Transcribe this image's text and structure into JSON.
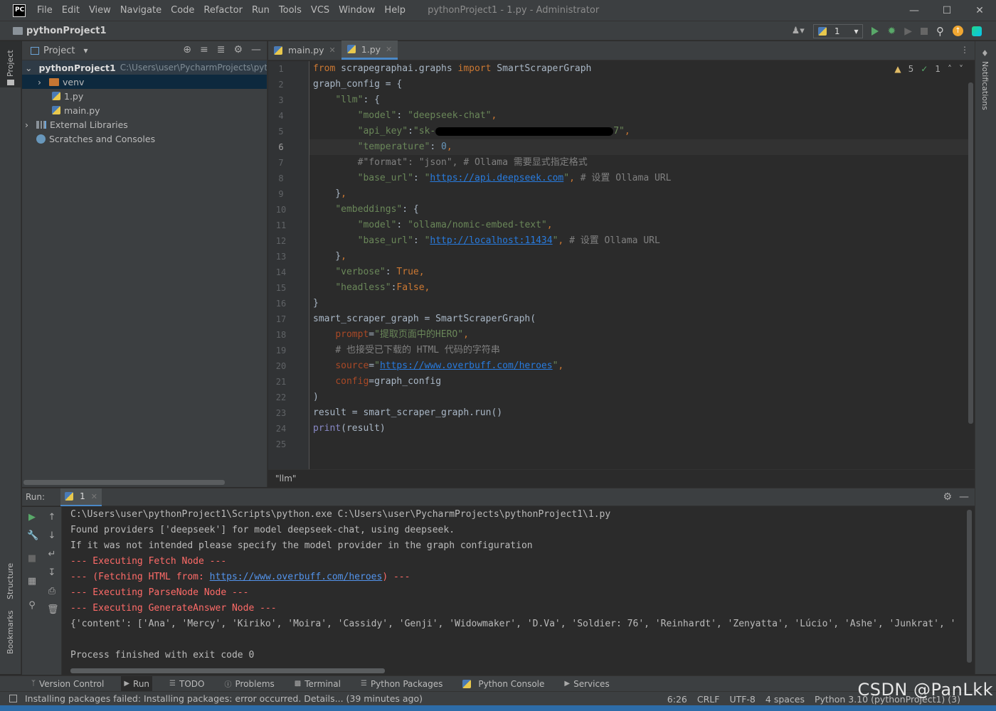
{
  "titlebar": {
    "logo": "PC",
    "menu": [
      "File",
      "Edit",
      "View",
      "Navigate",
      "Code",
      "Refactor",
      "Run",
      "Tools",
      "VCS",
      "Window",
      "Help"
    ],
    "window_title": "pythonProject1 - 1.py - Administrator"
  },
  "navbar": {
    "project": "pythonProject1",
    "run_config": "1"
  },
  "left_stripe": {
    "project": "Project",
    "structure": "Structure",
    "bookmarks": "Bookmarks"
  },
  "right_stripe": {
    "notifications": "Notifications"
  },
  "project_panel": {
    "title": "Project",
    "root_name": "pythonProject1",
    "root_path": "C:\\Users\\user\\PycharmProjects\\pyth",
    "items": [
      "venv",
      "1.py",
      "main.py"
    ],
    "external": "External Libraries",
    "scratches": "Scratches and Consoles"
  },
  "editor": {
    "tabs": [
      "main.py",
      "1.py"
    ],
    "active_tab": "1.py",
    "inspections": {
      "warnings": "5",
      "ok": "1"
    },
    "line_numbers": [
      "1",
      "2",
      "3",
      "4",
      "5",
      "6",
      "7",
      "8",
      "9",
      "10",
      "11",
      "12",
      "13",
      "14",
      "15",
      "16",
      "17",
      "18",
      "19",
      "20",
      "21",
      "22",
      "23",
      "24",
      "25"
    ],
    "breadcrumb": "\"llm\""
  },
  "run": {
    "label": "Run:",
    "tab": "1",
    "console": [
      "C:\\Users\\user\\pythonProject1\\Scripts\\python.exe C:\\Users\\user\\PycharmProjects\\pythonProject1\\1.py",
      "Found providers ['deepseek'] for model deepseek-chat, using deepseek.",
      "If it was not intended please specify the model provider in the graph configuration",
      "--- Executing Fetch Node ---",
      "--- (Fetching HTML from: ",
      "https://www.overbuff.com/heroes",
      ") ---",
      "--- Executing ParseNode Node ---",
      "--- Executing GenerateAnswer Node ---",
      "{'content': ['Ana', 'Mercy', 'Kiriko', 'Moira', 'Cassidy', 'Genji', 'Widowmaker', 'D.Va', 'Soldier: 76', 'Reinhardt', 'Zenyatta', 'Lúcio', 'Ashe', 'Junkrat', '",
      "Process finished with exit code 0"
    ]
  },
  "bottom_tabs": [
    "Version Control",
    "Run",
    "TODO",
    "Problems",
    "Terminal",
    "Python Packages",
    "Python Console",
    "Services"
  ],
  "status": {
    "message": "Installing packages failed: Installing packages: error occurred. Details... (39 minutes ago)",
    "position": "6:26",
    "line_sep": "CRLF",
    "encoding": "UTF-8",
    "indent": "4 spaces",
    "interpreter": "Python 3.10 (pythonProject1) (3)"
  },
  "watermark": "CSDN @PanLkk"
}
